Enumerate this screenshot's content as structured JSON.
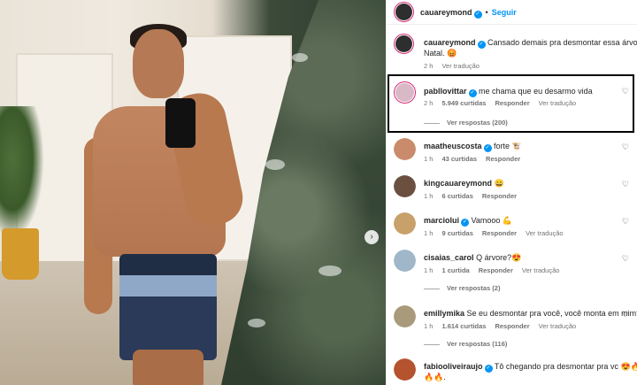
{
  "post": {
    "author": "cauareymond",
    "follow_label": "Seguir",
    "dot": "•",
    "caption_user": "cauareymond",
    "caption_text": "Cansado demais pra desmontar essa árvore de",
    "caption_text2": "Natal. 😡",
    "caption_time": "2 h",
    "caption_translate": "Ver tradução"
  },
  "comments": [
    {
      "user": "pabllovittar",
      "verified": true,
      "text": "me chama que eu desarmo vida",
      "time": "2 h",
      "likes": "5.949 curtidas",
      "reply": "Responder",
      "translate": "Ver tradução",
      "replies": "Ver respostas (200)",
      "avatar_color": "#d9b9c6"
    },
    {
      "user": "maatheuscosta",
      "verified": true,
      "text": "forte 🐮",
      "time": "1 h",
      "likes": "43 curtidas",
      "reply": "Responder",
      "translate": "",
      "replies": "",
      "avatar_color": "#c98b6b"
    },
    {
      "user": "kingcauareymond",
      "verified": false,
      "text": "😄",
      "time": "1 h",
      "likes": "6 curtidas",
      "reply": "Responder",
      "translate": "",
      "replies": "",
      "avatar_color": "#6b4f3f"
    },
    {
      "user": "marciolui",
      "verified": true,
      "text": "Vamooo 💪",
      "time": "1 h",
      "likes": "9 curtidas",
      "reply": "Responder",
      "translate": "Ver tradução",
      "replies": "",
      "avatar_color": "#c8a06a"
    },
    {
      "user": "cisaias_carol",
      "verified": false,
      "text": "Q árvore?😍",
      "time": "1 h",
      "likes": "1 curtida",
      "reply": "Responder",
      "translate": "Ver tradução",
      "replies": "Ver respostas (2)",
      "avatar_color": "#9fb7c9"
    },
    {
      "user": "emillymika",
      "verified": false,
      "text": "Se eu desmontar pra você, você monta em mim?",
      "time": "1 h",
      "likes": "1.614 curtidas",
      "reply": "Responder",
      "translate": "Ver tradução",
      "replies": "Ver respostas (116)",
      "avatar_color": "#a89a7a"
    },
    {
      "user": "fabiooliveiraujo",
      "verified": true,
      "text": "Tô chegando pra desmontar pra vc 😍🔥🔥🔥",
      "text2": "🔥🔥.",
      "time": "",
      "likes": "",
      "reply": "",
      "translate": "",
      "replies": "",
      "avatar_color": "#b5532f"
    }
  ],
  "icons": {
    "heart": "heart-icon",
    "next": "chevron-right-icon",
    "verified": "verified-badge-icon"
  },
  "glyphs": {
    "heart": "♡",
    "next": "›",
    "check": "✓"
  },
  "colors": {
    "accent": "#0095f6",
    "ring": "#d62976",
    "muted": "#737373"
  }
}
